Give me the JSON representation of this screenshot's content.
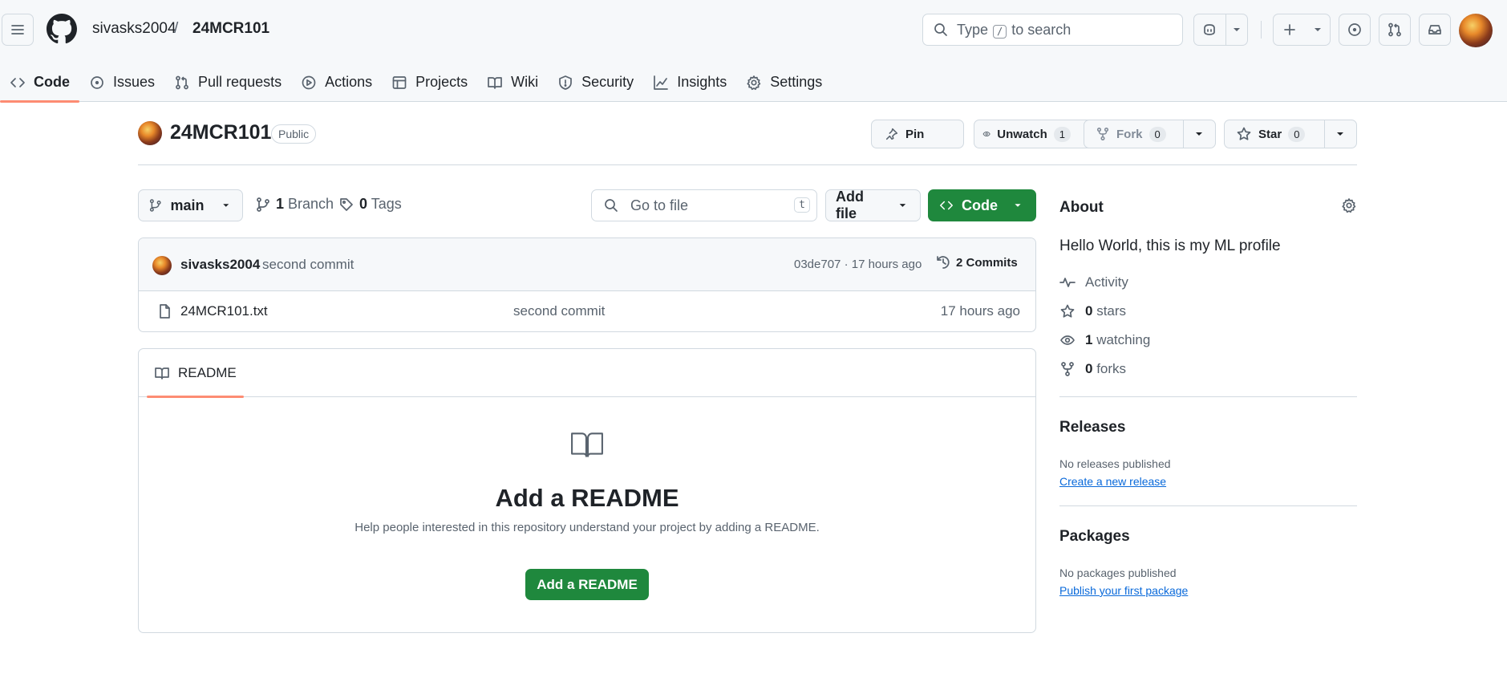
{
  "header": {
    "owner": "sivasks2004",
    "separator": "/",
    "repo": "24MCR101",
    "search": {
      "text_before": "Type",
      "key": "/",
      "text_after": "to search"
    }
  },
  "tabs": [
    {
      "label": "Code",
      "icon": "code-icon",
      "active": true
    },
    {
      "label": "Issues",
      "icon": "issue-opened-icon"
    },
    {
      "label": "Pull requests",
      "icon": "git-pull-request-icon"
    },
    {
      "label": "Actions",
      "icon": "play-icon"
    },
    {
      "label": "Projects",
      "icon": "table-icon"
    },
    {
      "label": "Wiki",
      "icon": "book-icon"
    },
    {
      "label": "Security",
      "icon": "shield-icon"
    },
    {
      "label": "Insights",
      "icon": "graph-icon"
    },
    {
      "label": "Settings",
      "icon": "gear-icon"
    }
  ],
  "repo": {
    "name": "24MCR101",
    "visibility": "Public",
    "pin_label": "Pin",
    "unwatch_label": "Unwatch",
    "watch_count": "1",
    "fork_label": "Fork",
    "fork_count": "0",
    "star_label": "Star",
    "star_count": "0"
  },
  "file_nav": {
    "branch": "main",
    "branch_count": "1",
    "branch_label": "Branch",
    "tag_count": "0",
    "tag_label": "Tags",
    "goto_placeholder": "Go to file",
    "goto_key": "t",
    "add_file_label": "Add file",
    "code_label": "Code"
  },
  "latest_commit": {
    "author": "sivasks2004",
    "message": "second commit",
    "meta": "03de707 · 17 hours ago",
    "commits_label": "2 Commits"
  },
  "files": [
    {
      "name": "24MCR101.txt",
      "commit": "second commit",
      "time": "17 hours ago"
    }
  ],
  "readme": {
    "tab_label": "README",
    "title": "Add a README",
    "description": "Help people interested in this repository understand your project by adding a README.",
    "button_label": "Add a README"
  },
  "about": {
    "heading": "About",
    "description": "Hello World, this is my ML profile",
    "activity_label": "Activity",
    "stars_count": "0",
    "stars_label": "stars",
    "watching_count": "1",
    "watching_label": "watching",
    "forks_count": "0",
    "forks_label": "forks"
  },
  "releases": {
    "heading": "Releases",
    "empty_text": "No releases published",
    "link": "Create a new release"
  },
  "packages": {
    "heading": "Packages",
    "empty_text": "No packages published",
    "link": "Publish your first package"
  },
  "colors": {
    "accent_green": "#1f883d",
    "tab_underline": "#fd8c73",
    "link_blue": "#0969da"
  }
}
